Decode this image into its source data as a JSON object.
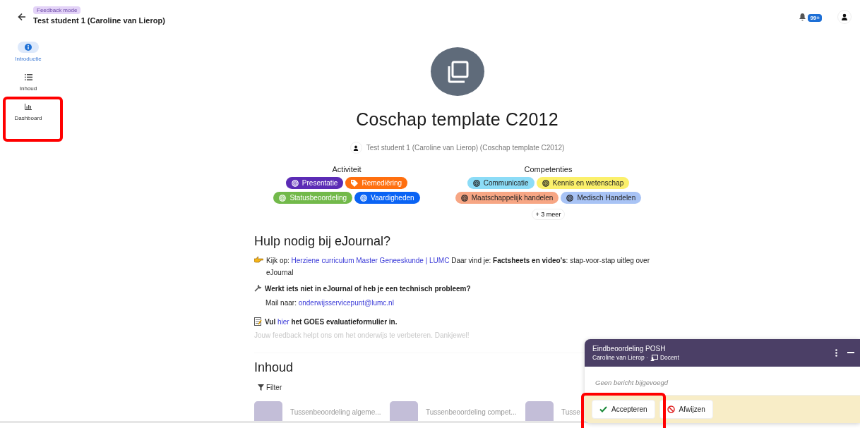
{
  "header": {
    "mode_badge": "Feedback mode",
    "title": "Test student 1 (Caroline van Lierop)",
    "notification_count": "99+"
  },
  "nav": [
    {
      "label": "Introductie",
      "kind": "info",
      "selected": true
    },
    {
      "label": "Inhoud",
      "kind": "list",
      "selected": false
    },
    {
      "label": "Dashboard",
      "kind": "chart",
      "selected": false
    }
  ],
  "journal": {
    "title": "Coschap template C2012",
    "subtitle": "Test student 1 (Caroline van Lierop) (Coschap template C2012)"
  },
  "tag_groups": [
    {
      "heading": "Activiteit",
      "tags": [
        {
          "label": "Presentatie",
          "kind": "target",
          "color": "#5b2bb5"
        },
        {
          "label": "Remediëring",
          "kind": "tag",
          "color": "#ff6f0f"
        },
        {
          "label": "Statusbeoordeling",
          "kind": "target",
          "color": "#72b94a"
        },
        {
          "label": "Vaardigheden",
          "kind": "target",
          "color": "#0a63f4"
        }
      ]
    },
    {
      "heading": "Competenties",
      "tags": [
        {
          "label": "Communicatie",
          "kind": "target",
          "color": "#8cdcf7"
        },
        {
          "label": "Kennis en wetenschap",
          "kind": "target",
          "color": "#fbf06b"
        },
        {
          "label": "Maatschappelijk handelen",
          "kind": "target",
          "color": "#f7a684"
        },
        {
          "label": "Medisch Handelen",
          "kind": "target",
          "color": "#a8c3f5"
        }
      ],
      "more": "+ 3 meer"
    }
  ],
  "help": {
    "title": "Hulp nodig bij eJournal?",
    "paragraphs": [
      {
        "kind": "hand",
        "parts": [
          {
            "kind": "text",
            "text": "Kijk op: "
          },
          {
            "kind": "link",
            "text": "Herziene curriculum Master Geneeskunde | LUMC"
          },
          {
            "kind": "text",
            "text": " Daar vind je: "
          },
          {
            "kind": "bold",
            "text": "Factsheets en video's"
          },
          {
            "kind": "text",
            "text": ": stap-voor-stap uitleg over eJournal"
          }
        ]
      },
      {
        "kind": "wrench",
        "parts": [
          {
            "kind": "bold",
            "text": "Werkt iets niet in eJournal of heb je een technisch probleem?"
          }
        ]
      },
      {
        "kind": "indented",
        "parts": [
          {
            "kind": "text",
            "text": "Mail naar: "
          },
          {
            "kind": "link",
            "text": "onderwijsservicepunt@lumc.nl"
          }
        ]
      },
      {
        "kind": "memo",
        "parts": [
          {
            "kind": "bold",
            "text": "Vul "
          },
          {
            "kind": "link",
            "text": "hier"
          },
          {
            "kind": "bold",
            "text": " het GOES evaluatieformulier in."
          }
        ]
      },
      {
        "kind": "faded",
        "parts": [
          {
            "kind": "text",
            "text": "Jouw feedback helpt ons om het onderwijs te verbeteren. Dankjewel!"
          }
        ]
      }
    ]
  },
  "contents": {
    "title": "Inhoud",
    "filter": "Filter",
    "cards": [
      {
        "title": "Tussenbeoordeling algeme..."
      },
      {
        "title": "Tussenbeoordeling compet..."
      },
      {
        "title": "Tusse"
      }
    ]
  },
  "feedback_popup": {
    "title": "Eindbeoordeling POSH",
    "author": "Caroline van Lierop ·",
    "role": "Docent",
    "message_placeholder": "Geen bericht bijgevoegd",
    "accept": "Accepteren",
    "reject": "Afwijzen"
  },
  "annotations": [
    {
      "kind": "highlight"
    },
    {
      "kind": "highlight"
    }
  ]
}
